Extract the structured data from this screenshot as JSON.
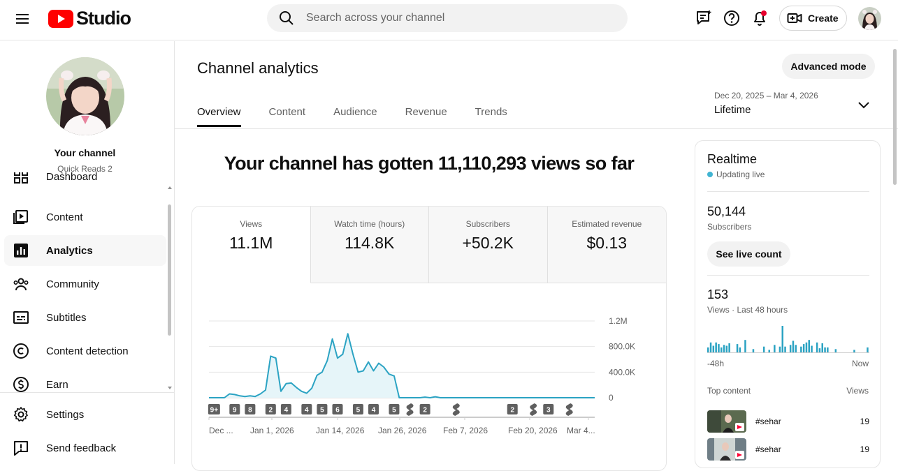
{
  "header": {
    "logo_text": "Studio",
    "search_placeholder": "Search across your channel",
    "create_label": "Create"
  },
  "sidebar": {
    "your_channel": "Your channel",
    "channel_name": "Quick Reads 2",
    "items": [
      {
        "label": "Dashboard",
        "icon": "dashboard-icon"
      },
      {
        "label": "Content",
        "icon": "content-icon"
      },
      {
        "label": "Analytics",
        "icon": "analytics-icon"
      },
      {
        "label": "Community",
        "icon": "community-icon"
      },
      {
        "label": "Subtitles",
        "icon": "subtitles-icon"
      },
      {
        "label": "Content detection",
        "icon": "copyright-icon"
      },
      {
        "label": "Earn",
        "icon": "dollar-icon"
      },
      {
        "label": "Settings",
        "icon": "gear-icon"
      },
      {
        "label": "Send feedback",
        "icon": "feedback-icon"
      }
    ]
  },
  "main": {
    "title": "Channel analytics",
    "advanced_mode": "Advanced mode",
    "tabs": [
      "Overview",
      "Content",
      "Audience",
      "Revenue",
      "Trends"
    ],
    "date_range": "Dec 20, 2025 – Mar 4, 2026",
    "period": "Lifetime",
    "headline": "Your channel has gotten 11,110,293 views so far",
    "metrics": [
      {
        "label": "Views",
        "value": "11.1M"
      },
      {
        "label": "Watch time (hours)",
        "value": "114.8K"
      },
      {
        "label": "Subscribers",
        "value": "+50.2K"
      },
      {
        "label": "Estimated revenue",
        "value": "$0.13"
      }
    ]
  },
  "chart_data": {
    "type": "area",
    "x_tick_labels": [
      "Dec ...",
      "Jan 1, 2026",
      "Jan 14, 2026",
      "Jan 26, 2026",
      "Feb 7, 2026",
      "Feb 20, 2026",
      "Mar 4..."
    ],
    "y_tick_labels": [
      "1.2M",
      "800.0K",
      "400.0K",
      "0"
    ],
    "ylim": [
      0,
      1200000
    ],
    "series": [
      {
        "values": [
          0,
          0,
          0,
          0,
          60000,
          50000,
          30000,
          20000,
          30000,
          20000,
          60000,
          120000,
          650000,
          620000,
          100000,
          220000,
          230000,
          160000,
          100000,
          70000,
          150000,
          350000,
          400000,
          580000,
          920000,
          620000,
          680000,
          1000000,
          680000,
          400000,
          420000,
          560000,
          420000,
          540000,
          480000,
          370000,
          340000,
          0,
          0,
          0,
          0,
          0,
          10000,
          0,
          15000,
          0,
          0,
          0,
          0,
          0,
          0,
          0,
          0,
          0,
          0,
          0,
          0,
          0,
          0,
          0,
          0,
          0,
          0,
          0,
          0,
          0,
          0,
          0,
          0,
          0,
          0,
          0,
          0,
          0,
          0,
          0
        ]
      }
    ],
    "markers": [
      {
        "day": 1,
        "label": "9+"
      },
      {
        "day": 5,
        "label": "9"
      },
      {
        "day": 8,
        "label": "8"
      },
      {
        "day": 12,
        "label": "2"
      },
      {
        "day": 15,
        "label": "4"
      },
      {
        "day": 19,
        "label": "4"
      },
      {
        "day": 22,
        "label": "5"
      },
      {
        "day": 25,
        "label": "6"
      },
      {
        "day": 29,
        "label": "5"
      },
      {
        "day": 32,
        "label": "4"
      },
      {
        "day": 36,
        "label": "5"
      },
      {
        "day": 39,
        "label": "short"
      },
      {
        "day": 42,
        "label": "2"
      },
      {
        "day": 48,
        "label": "short"
      },
      {
        "day": 59,
        "label": "2"
      },
      {
        "day": 63,
        "label": "short"
      },
      {
        "day": 66,
        "label": "3"
      },
      {
        "day": 70,
        "label": "short"
      }
    ],
    "grid": true
  },
  "realtime": {
    "title": "Realtime",
    "live_text": "Updating live",
    "subscribers_value": "50,144",
    "subscribers_label": "Subscribers",
    "see_live_count": "See live count",
    "views_value": "153",
    "views_label": "Views · Last 48 hours",
    "axis_start": "-48h",
    "axis_end": "Now",
    "bars": [
      6,
      12,
      8,
      12,
      10,
      6,
      9,
      8,
      11,
      0,
      0,
      10,
      6,
      0,
      15,
      0,
      0,
      4,
      0,
      0,
      0,
      7,
      0,
      3,
      0,
      9,
      0,
      7,
      32,
      7,
      0,
      9,
      14,
      9,
      0,
      7,
      10,
      12,
      15,
      8,
      0,
      12,
      5,
      11,
      6,
      6,
      0,
      0,
      4,
      0,
      0,
      0,
      0,
      0,
      0,
      3,
      0,
      0,
      0,
      0,
      6
    ],
    "top_content_label": "Top content",
    "views_col_label": "Views",
    "top_content": [
      {
        "title": "#sehar",
        "views": "19"
      },
      {
        "title": "#sehar",
        "views": "19"
      }
    ]
  }
}
